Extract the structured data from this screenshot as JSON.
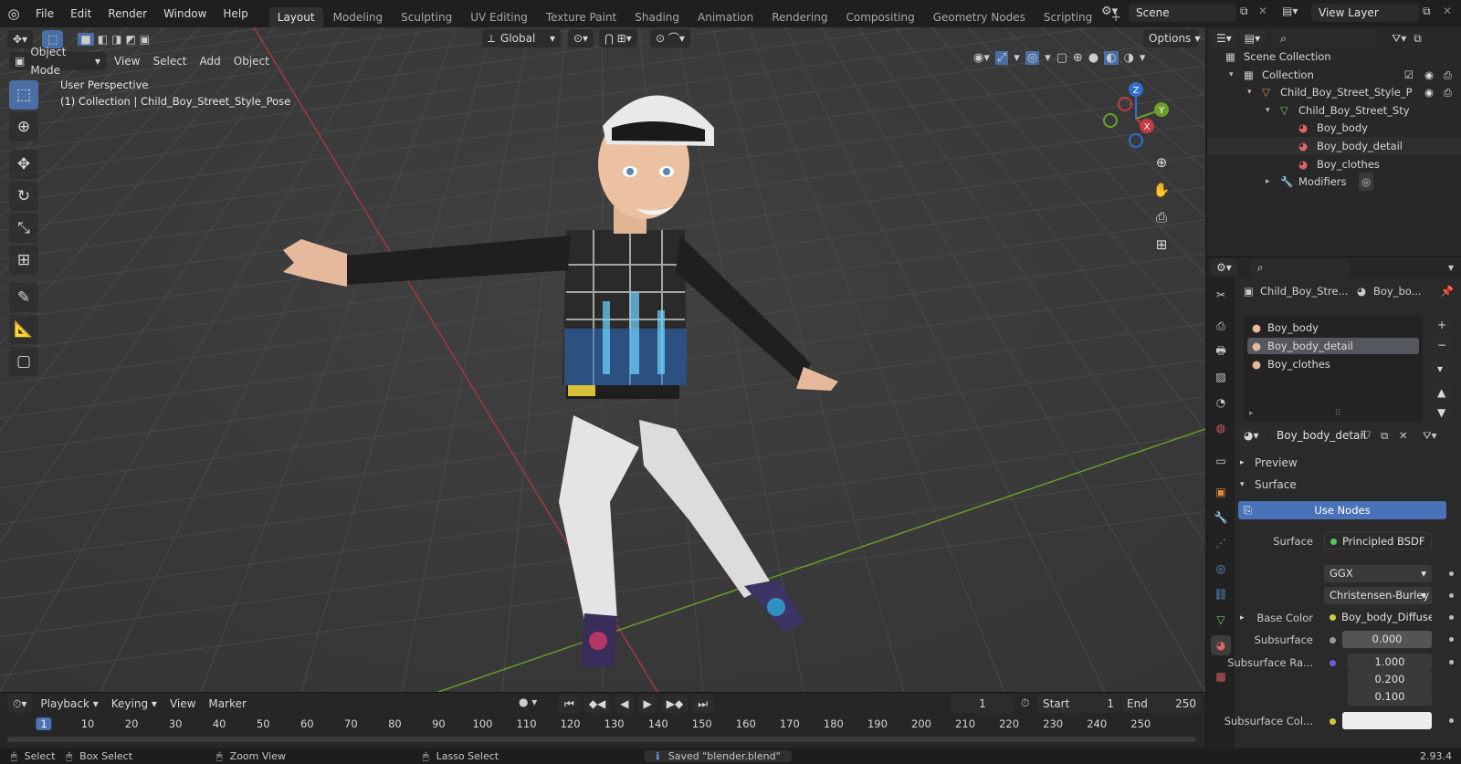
{
  "menu": [
    "File",
    "Edit",
    "Render",
    "Window",
    "Help"
  ],
  "workspaces": [
    "Layout",
    "Modeling",
    "Sculpting",
    "UV Editing",
    "Texture Paint",
    "Shading",
    "Animation",
    "Rendering",
    "Compositing",
    "Geometry Nodes",
    "Scripting"
  ],
  "active_workspace": "Layout",
  "scene": "Scene",
  "view_layer": "View Layer",
  "viewport": {
    "transform_orientation": "Global",
    "options": "Options",
    "mode": "Object Mode",
    "header_menus": [
      "View",
      "Select",
      "Add",
      "Object"
    ],
    "info_line1": "User Perspective",
    "info_line2": "(1) Collection | Child_Boy_Street_Style_Pose",
    "gizmo": {
      "z": "Z",
      "y": "Y",
      "x": "X"
    }
  },
  "outliner": {
    "rows": [
      {
        "label": "Scene Collection",
        "indent": 0
      },
      {
        "label": "Collection",
        "indent": 1
      },
      {
        "label": "Child_Boy_Street_Style_P",
        "indent": 2
      },
      {
        "label": "Child_Boy_Street_Sty",
        "indent": 3
      },
      {
        "label": "Boy_body",
        "indent": 4
      },
      {
        "label": "Boy_body_detail",
        "indent": 4
      },
      {
        "label": "Boy_clothes",
        "indent": 4
      },
      {
        "label": "Modifiers",
        "indent": 3
      }
    ]
  },
  "properties": {
    "breadcrumb_object": "Child_Boy_Stre...",
    "breadcrumb_material": "Boy_bo...",
    "material_slots": [
      "Boy_body",
      "Boy_body_detail",
      "Boy_clothes"
    ],
    "active_slot": "Boy_body_detail",
    "material_name": "Boy_body_detail",
    "panels": {
      "preview": "Preview",
      "surface": "Surface"
    },
    "use_nodes": "Use Nodes",
    "surface_label": "Surface",
    "surface_value": "Principled BSDF",
    "distribution": "GGX",
    "subsurface_method": "Christensen-Burley",
    "base_color_label": "Base Color",
    "base_color_value": "Boy_body_Diffuse....",
    "subsurface_label": "Subsurface",
    "subsurface_value": "0.000",
    "subsurface_radius_label": "Subsurface Ra...",
    "subsurface_radius": [
      "1.000",
      "0.200",
      "0.100"
    ],
    "subsurface_color_label": "Subsurface Col..."
  },
  "timeline": {
    "menus": [
      "Playback",
      "Keying",
      "View",
      "Marker"
    ],
    "current_frame": "1",
    "start_label": "Start",
    "start_value": "1",
    "end_label": "End",
    "end_value": "250",
    "ticks": [
      "1",
      "10",
      "20",
      "30",
      "40",
      "50",
      "60",
      "70",
      "80",
      "90",
      "100",
      "110",
      "120",
      "130",
      "140",
      "150",
      "160",
      "170",
      "180",
      "190",
      "200",
      "210",
      "220",
      "230",
      "240",
      "250"
    ]
  },
  "status": {
    "select": "Select",
    "box_select": "Box Select",
    "zoom_view": "Zoom View",
    "lasso_select": "Lasso Select",
    "message": "Saved \"blender.blend\"",
    "version": "2.93.4"
  },
  "colors": {
    "accent": "#4a72b8",
    "active_tab": "#303030",
    "x_axis": "#c43a45",
    "y_axis": "#6e9e2a",
    "z_axis": "#2f6fd0"
  }
}
